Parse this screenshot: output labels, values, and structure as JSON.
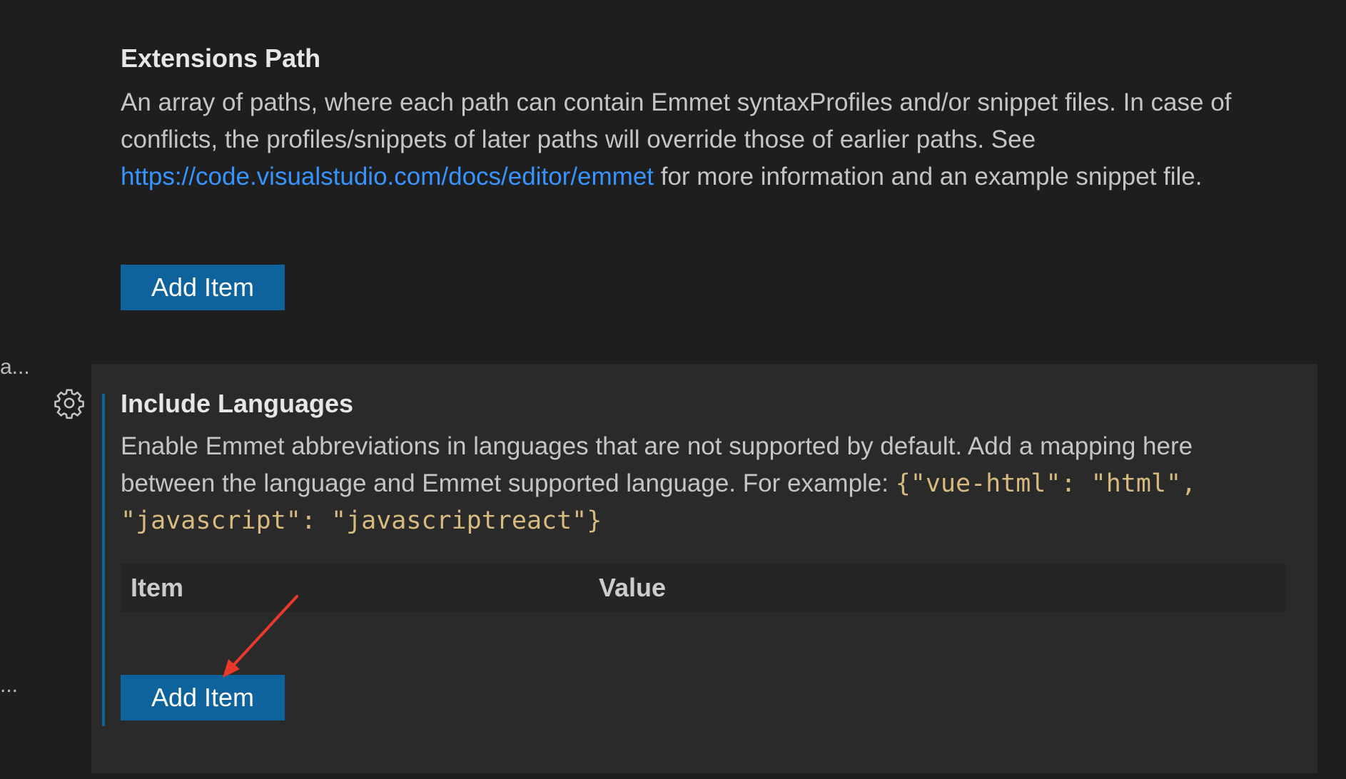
{
  "gutter": {
    "truncated_1": "a...",
    "truncated_2": "..."
  },
  "extensions_path": {
    "title": "Extensions Path",
    "desc_part1": "An array of paths, where each path can contain Emmet syntaxProfiles and/or snippet files. In case of conflicts, the profiles/snippets of later paths will override those of earlier paths. See ",
    "link": "https://code.visualstudio.com/docs/editor/emmet",
    "desc_part2": " for more information and an example snippet file.",
    "button_label": "Add Item"
  },
  "include_languages": {
    "title": "Include Languages",
    "desc_part1": "Enable Emmet abbreviations in languages that are not supported by default. Add a mapping here between the language and Emmet supported language. For example: ",
    "code": "{\"vue-html\": \"html\", \"javascript\": \"javascriptreact\"}",
    "table_headers": {
      "item": "Item",
      "value": "Value"
    },
    "button_label": "Add Item",
    "gear_icon": "gear-icon"
  },
  "colors": {
    "background": "#1e1e1e",
    "focused_background": "#2a2a2a",
    "button": "#0e639c",
    "link": "#3794ff",
    "code": "#d7ba7d",
    "annotation_arrow": "#e8392b"
  }
}
